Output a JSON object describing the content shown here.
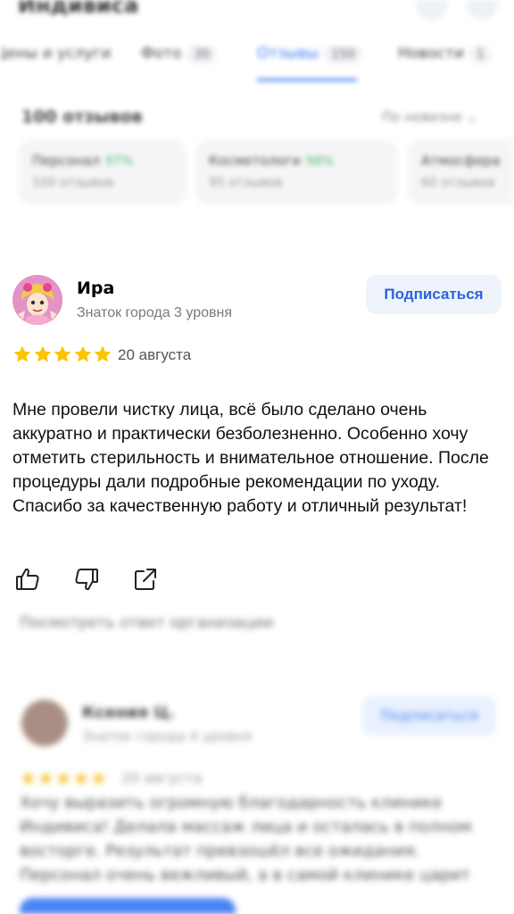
{
  "background_top": {
    "header_title": "Индивиса",
    "tabs": [
      {
        "label": "Цены и услуги",
        "count": ""
      },
      {
        "label": "Фото",
        "count": "30"
      },
      {
        "label": "Отзывы",
        "count": "150"
      },
      {
        "label": "Новости",
        "count": "1"
      }
    ],
    "reviews_total": "100 отзывов",
    "sort_label": "По новизне",
    "aspects": [
      {
        "title": "Персонал",
        "percent": "97%",
        "sub": "100 отзывов"
      },
      {
        "title": "Косметологи",
        "percent": "98%",
        "sub": "95 отзывов"
      },
      {
        "title": "Атмосфера",
        "percent": "",
        "sub": "60 отзывов"
      }
    ]
  },
  "review": {
    "author_name": "Ира",
    "author_level": "Знаток города 3 уровня",
    "subscribe_label": "Подписаться",
    "rating": 5,
    "date": "20 августа",
    "text": "Мне провели чистку лица, всё было сделано очень аккуратно и практически безболезненно. Особенно хочу отметить стерильность и внимательное отношение. После процедуры дали подробные рекомендации по уходу. Спасибо за качественную работу и отличный результат!",
    "actions": [
      "like",
      "dislike",
      "share"
    ]
  },
  "background_bottom": {
    "show_reply": "Посмотреть ответ организации",
    "author_name": "Ксения Ц.",
    "author_level": "Знаток города 4 уровня",
    "subscribe_label": "Подписаться",
    "stars": "★★★★★",
    "date": "20 августа",
    "text": "Хочу выразить огромную благодарность клинике Индивиса! Делала массаж лица и осталась в полном восторге. Результат превзошёл все ожидания. Персонал очень вежливый, а в самой клинике царит"
  },
  "colors": {
    "star": "#fbc400",
    "accent": "#2e63d9",
    "subscribe_bg": "#eef3fc",
    "avatar_bg": "#e493c6"
  }
}
